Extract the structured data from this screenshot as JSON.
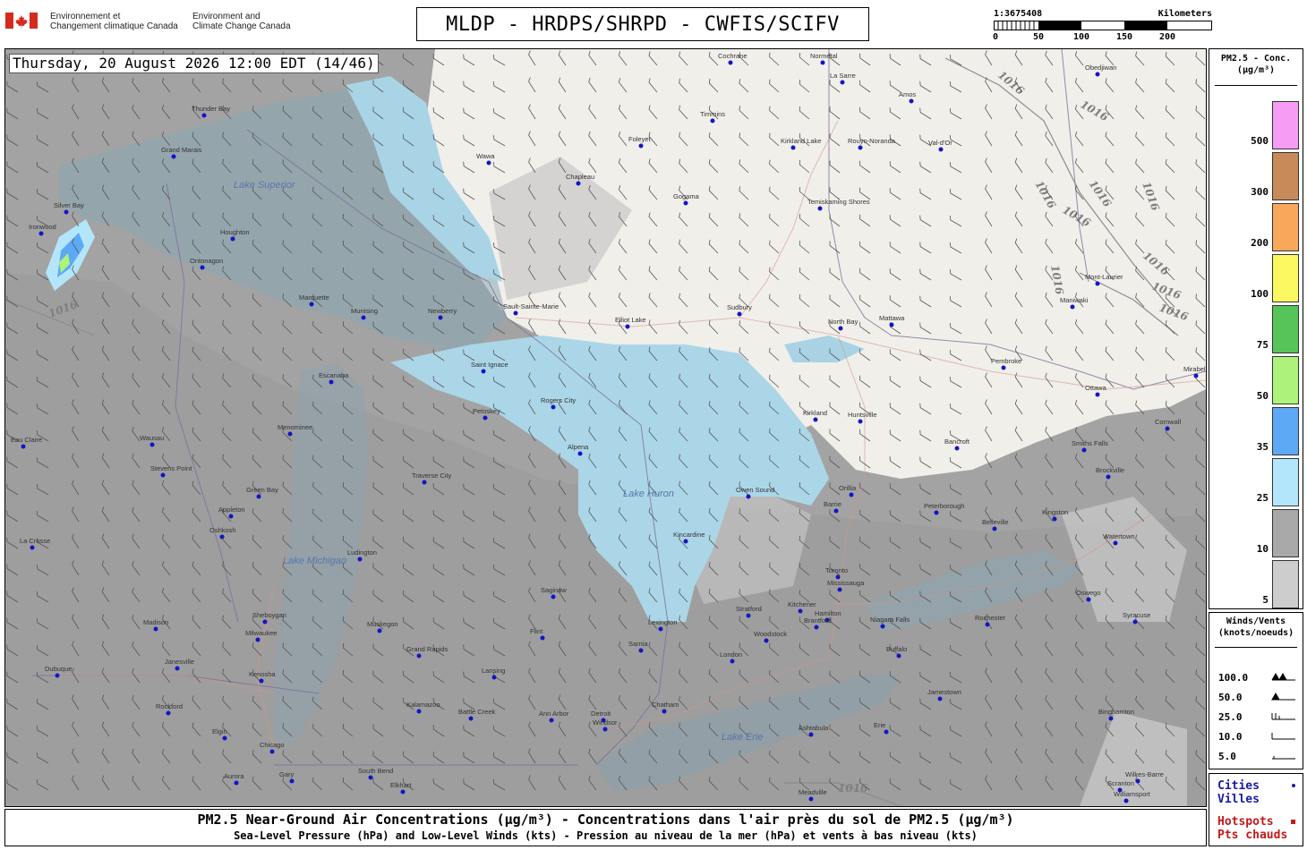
{
  "header": {
    "agency_fr": [
      "Environnement et",
      "Changement climatique Canada"
    ],
    "agency_en": [
      "Environment and",
      "Climate Change Canada"
    ],
    "title": "MLDP - HRDPS/SHRPD - CWFIS/SCIFV",
    "scale": {
      "ratio": "1:3675408",
      "units": "Kilometers",
      "ticks": [
        "0",
        "50",
        "100",
        "150",
        "200"
      ]
    }
  },
  "map": {
    "timestamp": "Thursday, 20 August 2026 12:00 EDT (14/46)",
    "water_labels": [
      "Lake Superior",
      "Lake Huron",
      "Lake Michigan",
      "Lake Erie"
    ],
    "isobar_label": "1016",
    "cities": [
      "Cochrane",
      "Normétal",
      "La Sarre",
      "Amos",
      "Obedjiwan",
      "Timmins",
      "Foleyet",
      "Kirkland Lake",
      "Rouyn-Noranda",
      "Val-d'Or",
      "Wawa",
      "Chapleau",
      "Gogama",
      "Temiskaming Shores",
      "Sault-Sainte-Marie",
      "Elliot Lake",
      "Sudbury",
      "North Bay",
      "Mattawa",
      "Maniwaki",
      "Mont-Laurier",
      "Pembroke",
      "Ottawa",
      "Mirabel",
      "Cornwall",
      "Huntsville",
      "Bancroft",
      "Smiths Falls",
      "Brockville",
      "Orillia",
      "Barrie",
      "Peterborough",
      "Belleville",
      "Kingston",
      "Watertown",
      "Toronto",
      "Mississauga",
      "Hamilton",
      "Niagara Falls",
      "Buffalo",
      "Rochester",
      "Syracuse",
      "Oswego",
      "Stratford",
      "London",
      "Woodstock",
      "Brantford",
      "Kitchener",
      "Owen Sound",
      "Kincardine",
      "Sarnia",
      "Lexington",
      "Detroit",
      "Windsor",
      "Chatham",
      "Ann Arbor",
      "Lansing",
      "Grand Rapids",
      "Flint",
      "Saginaw",
      "Alpena",
      "Rogers City",
      "Petoskey",
      "Saint Ignace",
      "Newberry",
      "Marquette",
      "Munising",
      "Escanaba",
      "Menominee",
      "Sheboygan",
      "Milwaukee",
      "Kenosha",
      "Chicago",
      "Gary",
      "South Bend",
      "Elkhart",
      "Kalamazoo",
      "Battle Creek",
      "Muskegon",
      "Ludington",
      "Traverse City",
      "Green Bay",
      "Appleton",
      "Oshkosh",
      "Madison",
      "Janesville",
      "Rockford",
      "Dubuque",
      "Elgin",
      "Aurora",
      "Wausau",
      "Stevens Point",
      "Eau Claire",
      "La Crosse",
      "Ashtabula",
      "Erie",
      "Jamestown",
      "Binghamton",
      "Scranton",
      "Williamsport",
      "Meadville",
      "Ironwood",
      "Ontonagon",
      "Houghton",
      "Thunder Bay",
      "Grand Marais",
      "Silver Bay",
      "Kirkland",
      "Wilkes-Barre"
    ]
  },
  "legend_pm": {
    "title": [
      "PM2.5 - Conc.",
      "(µg/m³)"
    ],
    "levels": [
      {
        "label": "500",
        "color": "#f79cf5"
      },
      {
        "label": "300",
        "color": "#c78a58"
      },
      {
        "label": "200",
        "color": "#f9a75a"
      },
      {
        "label": "100",
        "color": "#fbf760"
      },
      {
        "label": "75",
        "color": "#57c45a"
      },
      {
        "label": "50",
        "color": "#adf27a"
      },
      {
        "label": "35",
        "color": "#5ea9f5"
      },
      {
        "label": "25",
        "color": "#b3e6fb"
      },
      {
        "label": "10",
        "color": "#a8a8a8"
      },
      {
        "label": "5",
        "color": "#cdcdcd"
      }
    ]
  },
  "legend_wind": {
    "title": [
      "Winds/Vents",
      "(knots/noeuds)"
    ],
    "rows": [
      "100.0",
      "50.0",
      "25.0",
      "10.0",
      "5.0"
    ]
  },
  "legend_cities": {
    "cities": [
      "Cities",
      "Villes"
    ],
    "hotspots": [
      "Hotspots",
      "Pts chauds"
    ]
  },
  "footer": {
    "line1": "PM2.5 Near-Ground Air Concentrations (µg/m³) - Concentrations dans l'air près du sol de PM2.5 (µg/m³)",
    "line2": "Sea-Level Pressure (hPa) and Low-Level Winds (kts) - Pression au niveau de la mer (hPa) et vents à bas niveau (kts)"
  }
}
